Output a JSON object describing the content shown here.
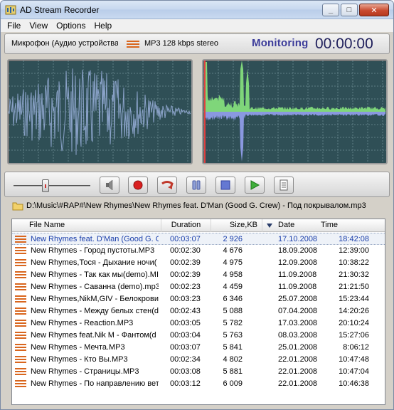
{
  "window": {
    "title": "AD Stream Recorder",
    "controls": {
      "minimize": "_",
      "maximize": "□",
      "close": "✕"
    }
  },
  "menu": {
    "items": [
      "File",
      "View",
      "Options",
      "Help"
    ]
  },
  "info": {
    "device": "Микрофон (Аудио устройства",
    "format": "MP3 128 kbps stereo",
    "status": "Monitoring",
    "time": "00:00:00"
  },
  "controls": {
    "volume_level": 0.42,
    "buttons": [
      "speaker-icon",
      "record-icon",
      "loop-icon",
      "pause-icon",
      "stop-icon",
      "play-icon",
      "notes-icon"
    ]
  },
  "path": "D:\\Music\\#RAP#\\New Rhymes\\New Rhymes feat. D'Man (Good G. Crew) - Под покрывалом.mp3",
  "file_list": {
    "columns": {
      "name": "File Name",
      "duration": "Duration",
      "size": "Size,KB",
      "date": "Date",
      "time": "Time"
    },
    "rows": [
      {
        "name": "New Rhymes feat. D'Man (Good G. C",
        "duration": "00:03:07",
        "size": "2 926",
        "date": "17.10.2008",
        "time": "18:42:08",
        "selected": true
      },
      {
        "name": "New Rhymes - Город пустоты.MP3",
        "duration": "00:02:30",
        "size": "4 676",
        "date": "18.09.2008",
        "time": "12:39:00"
      },
      {
        "name": "New Rhymes,Тося - Дыхание ночи(",
        "duration": "00:02:39",
        "size": "4 975",
        "date": "12.09.2008",
        "time": "10:38:22"
      },
      {
        "name": "New Rhymes - Так как мы(demo).MI",
        "duration": "00:02:39",
        "size": "4 958",
        "date": "11.09.2008",
        "time": "21:30:32"
      },
      {
        "name": "New Rhymes - Саванна (demo).mp3",
        "duration": "00:02:23",
        "size": "4 459",
        "date": "11.09.2008",
        "time": "21:21:50"
      },
      {
        "name": "New Rhymes,NikM,GIV - Белокрови",
        "duration": "00:03:23",
        "size": "6 346",
        "date": "25.07.2008",
        "time": "15:23:44"
      },
      {
        "name": "New Rhymes - Между белых стен(d",
        "duration": "00:02:43",
        "size": "5 088",
        "date": "07.04.2008",
        "time": "14:20:26"
      },
      {
        "name": "New Rhymes - Reaction.MP3",
        "duration": "00:03:05",
        "size": "5 782",
        "date": "17.03.2008",
        "time": "20:10:24"
      },
      {
        "name": "New Rhymes feat.Nik M - Фантом(d",
        "duration": "00:03:04",
        "size": "5 763",
        "date": "08.03.2008",
        "time": "15:27:06"
      },
      {
        "name": "New Rhymes - Мечта.MP3",
        "duration": "00:03:07",
        "size": "5 841",
        "date": "25.01.2008",
        "time": "8:06:12"
      },
      {
        "name": "New Rhymes - Кто Вы.MP3",
        "duration": "00:02:34",
        "size": "4 802",
        "date": "22.01.2008",
        "time": "10:47:48"
      },
      {
        "name": "New Rhymes - Страницы.MP3",
        "duration": "00:03:08",
        "size": "5 881",
        "date": "22.01.2008",
        "time": "10:47:04"
      },
      {
        "name": "New Rhymes - По направлению вет",
        "duration": "00:03:12",
        "size": "6 009",
        "date": "22.01.2008",
        "time": "10:46:38"
      }
    ]
  },
  "colors": {
    "scope_bg": "#2f4f56",
    "grid": "#5f7f85",
    "wave": "#8aa2c8",
    "spectrum_top": "#7fd67a",
    "spectrum_bottom": "#8a98e0",
    "selected_text": "#1a3eaa"
  }
}
